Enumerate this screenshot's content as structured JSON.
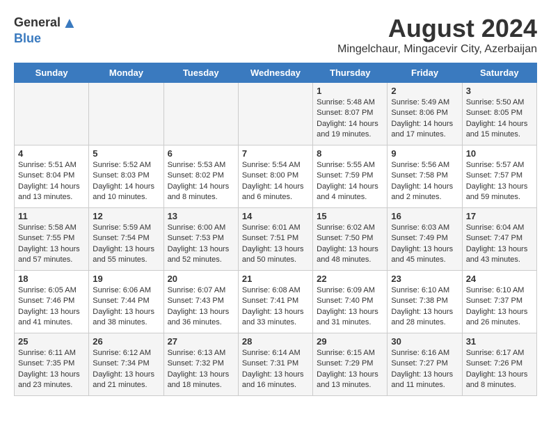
{
  "logo": {
    "general": "General",
    "blue": "Blue"
  },
  "title": "August 2024",
  "subtitle": "Mingelchaur, Mingacevir City, Azerbaijan",
  "headers": [
    "Sunday",
    "Monday",
    "Tuesday",
    "Wednesday",
    "Thursday",
    "Friday",
    "Saturday"
  ],
  "weeks": [
    [
      {
        "day": "",
        "lines": []
      },
      {
        "day": "",
        "lines": []
      },
      {
        "day": "",
        "lines": []
      },
      {
        "day": "",
        "lines": []
      },
      {
        "day": "1",
        "lines": [
          "Sunrise: 5:48 AM",
          "Sunset: 8:07 PM",
          "Daylight: 14 hours",
          "and 19 minutes."
        ]
      },
      {
        "day": "2",
        "lines": [
          "Sunrise: 5:49 AM",
          "Sunset: 8:06 PM",
          "Daylight: 14 hours",
          "and 17 minutes."
        ]
      },
      {
        "day": "3",
        "lines": [
          "Sunrise: 5:50 AM",
          "Sunset: 8:05 PM",
          "Daylight: 14 hours",
          "and 15 minutes."
        ]
      }
    ],
    [
      {
        "day": "4",
        "lines": [
          "Sunrise: 5:51 AM",
          "Sunset: 8:04 PM",
          "Daylight: 14 hours",
          "and 13 minutes."
        ]
      },
      {
        "day": "5",
        "lines": [
          "Sunrise: 5:52 AM",
          "Sunset: 8:03 PM",
          "Daylight: 14 hours",
          "and 10 minutes."
        ]
      },
      {
        "day": "6",
        "lines": [
          "Sunrise: 5:53 AM",
          "Sunset: 8:02 PM",
          "Daylight: 14 hours",
          "and 8 minutes."
        ]
      },
      {
        "day": "7",
        "lines": [
          "Sunrise: 5:54 AM",
          "Sunset: 8:00 PM",
          "Daylight: 14 hours",
          "and 6 minutes."
        ]
      },
      {
        "day": "8",
        "lines": [
          "Sunrise: 5:55 AM",
          "Sunset: 7:59 PM",
          "Daylight: 14 hours",
          "and 4 minutes."
        ]
      },
      {
        "day": "9",
        "lines": [
          "Sunrise: 5:56 AM",
          "Sunset: 7:58 PM",
          "Daylight: 14 hours",
          "and 2 minutes."
        ]
      },
      {
        "day": "10",
        "lines": [
          "Sunrise: 5:57 AM",
          "Sunset: 7:57 PM",
          "Daylight: 13 hours",
          "and 59 minutes."
        ]
      }
    ],
    [
      {
        "day": "11",
        "lines": [
          "Sunrise: 5:58 AM",
          "Sunset: 7:55 PM",
          "Daylight: 13 hours",
          "and 57 minutes."
        ]
      },
      {
        "day": "12",
        "lines": [
          "Sunrise: 5:59 AM",
          "Sunset: 7:54 PM",
          "Daylight: 13 hours",
          "and 55 minutes."
        ]
      },
      {
        "day": "13",
        "lines": [
          "Sunrise: 6:00 AM",
          "Sunset: 7:53 PM",
          "Daylight: 13 hours",
          "and 52 minutes."
        ]
      },
      {
        "day": "14",
        "lines": [
          "Sunrise: 6:01 AM",
          "Sunset: 7:51 PM",
          "Daylight: 13 hours",
          "and 50 minutes."
        ]
      },
      {
        "day": "15",
        "lines": [
          "Sunrise: 6:02 AM",
          "Sunset: 7:50 PM",
          "Daylight: 13 hours",
          "and 48 minutes."
        ]
      },
      {
        "day": "16",
        "lines": [
          "Sunrise: 6:03 AM",
          "Sunset: 7:49 PM",
          "Daylight: 13 hours",
          "and 45 minutes."
        ]
      },
      {
        "day": "17",
        "lines": [
          "Sunrise: 6:04 AM",
          "Sunset: 7:47 PM",
          "Daylight: 13 hours",
          "and 43 minutes."
        ]
      }
    ],
    [
      {
        "day": "18",
        "lines": [
          "Sunrise: 6:05 AM",
          "Sunset: 7:46 PM",
          "Daylight: 13 hours",
          "and 41 minutes."
        ]
      },
      {
        "day": "19",
        "lines": [
          "Sunrise: 6:06 AM",
          "Sunset: 7:44 PM",
          "Daylight: 13 hours",
          "and 38 minutes."
        ]
      },
      {
        "day": "20",
        "lines": [
          "Sunrise: 6:07 AM",
          "Sunset: 7:43 PM",
          "Daylight: 13 hours",
          "and 36 minutes."
        ]
      },
      {
        "day": "21",
        "lines": [
          "Sunrise: 6:08 AM",
          "Sunset: 7:41 PM",
          "Daylight: 13 hours",
          "and 33 minutes."
        ]
      },
      {
        "day": "22",
        "lines": [
          "Sunrise: 6:09 AM",
          "Sunset: 7:40 PM",
          "Daylight: 13 hours",
          "and 31 minutes."
        ]
      },
      {
        "day": "23",
        "lines": [
          "Sunrise: 6:10 AM",
          "Sunset: 7:38 PM",
          "Daylight: 13 hours",
          "and 28 minutes."
        ]
      },
      {
        "day": "24",
        "lines": [
          "Sunrise: 6:10 AM",
          "Sunset: 7:37 PM",
          "Daylight: 13 hours",
          "and 26 minutes."
        ]
      }
    ],
    [
      {
        "day": "25",
        "lines": [
          "Sunrise: 6:11 AM",
          "Sunset: 7:35 PM",
          "Daylight: 13 hours",
          "and 23 minutes."
        ]
      },
      {
        "day": "26",
        "lines": [
          "Sunrise: 6:12 AM",
          "Sunset: 7:34 PM",
          "Daylight: 13 hours",
          "and 21 minutes."
        ]
      },
      {
        "day": "27",
        "lines": [
          "Sunrise: 6:13 AM",
          "Sunset: 7:32 PM",
          "Daylight: 13 hours",
          "and 18 minutes."
        ]
      },
      {
        "day": "28",
        "lines": [
          "Sunrise: 6:14 AM",
          "Sunset: 7:31 PM",
          "Daylight: 13 hours",
          "and 16 minutes."
        ]
      },
      {
        "day": "29",
        "lines": [
          "Sunrise: 6:15 AM",
          "Sunset: 7:29 PM",
          "Daylight: 13 hours",
          "and 13 minutes."
        ]
      },
      {
        "day": "30",
        "lines": [
          "Sunrise: 6:16 AM",
          "Sunset: 7:27 PM",
          "Daylight: 13 hours",
          "and 11 minutes."
        ]
      },
      {
        "day": "31",
        "lines": [
          "Sunrise: 6:17 AM",
          "Sunset: 7:26 PM",
          "Daylight: 13 hours",
          "and 8 minutes."
        ]
      }
    ]
  ]
}
